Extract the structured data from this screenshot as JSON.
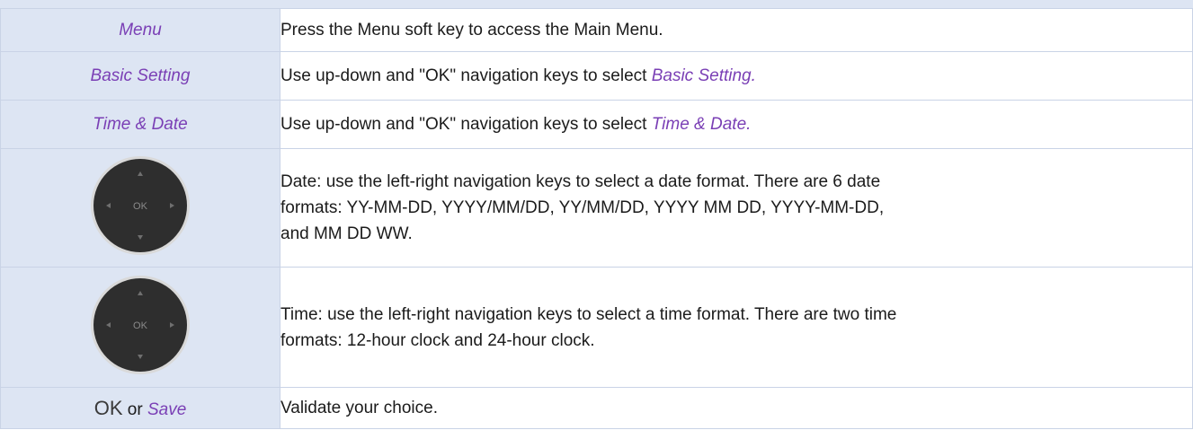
{
  "rows": [
    {
      "key": "Menu",
      "desc": "Press the Menu soft key to access the Main Menu."
    },
    {
      "key": "Basic Setting",
      "desc_prefix": "Use up-down and \"OK\" navigation keys to select ",
      "desc_em": "Basic Setting."
    },
    {
      "key": "Time & Date",
      "desc_prefix": "Use up-down and \"OK\" navigation keys to select ",
      "desc_em": "Time & Date."
    },
    {
      "key_icon": "navigation-pad-icon",
      "pad_label": "OK",
      "desc_lines": [
        "Date: use the left-right navigation keys to select a date format. There are 6 date",
        "formats: YY-MM-DD, YYYY/MM/DD, YY/MM/DD, YYYY MM DD, YYYY-MM-DD,",
        "and MM DD WW."
      ]
    },
    {
      "key_icon": "navigation-pad-icon",
      "pad_label": "OK",
      "desc_lines": [
        "Time: use the left-right navigation keys to select a time format. There are two time",
        "formats: 12-hour clock and 24-hour clock."
      ]
    },
    {
      "key_ok": "OK",
      "key_or": "or",
      "key_save": "Save",
      "desc": "Validate your choice."
    }
  ],
  "colors": {
    "key_text": "#7a3fb5",
    "key_cell_bg": "#dde5f3",
    "border": "#c9d3e6",
    "pad_body": "#2e2e2e",
    "pad_ring": "#d9d9d9"
  }
}
